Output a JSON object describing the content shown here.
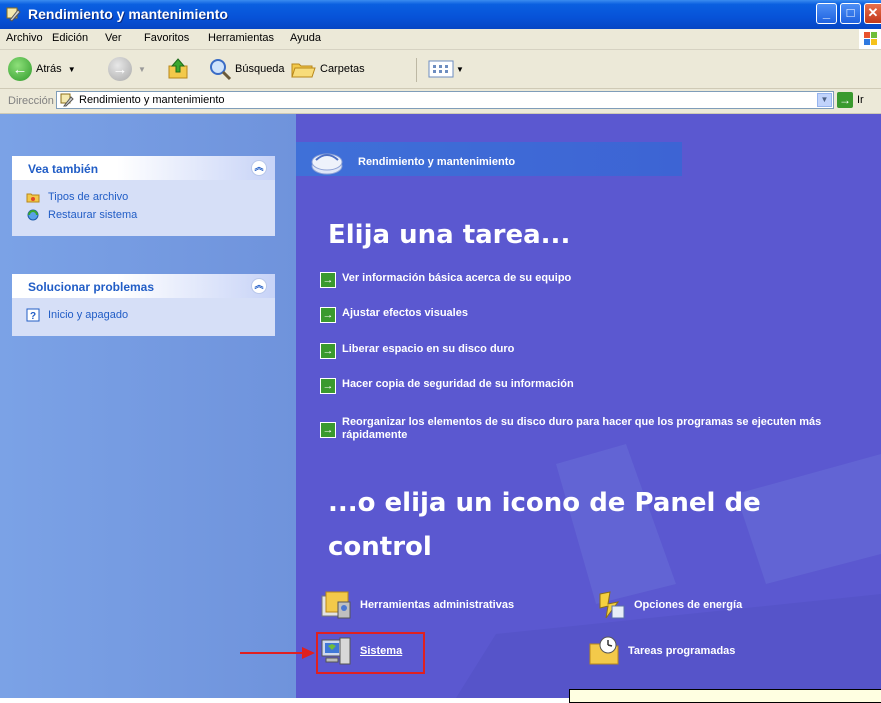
{
  "window": {
    "title": "Rendimiento y mantenimiento"
  },
  "menu": [
    "Archivo",
    "Edición",
    "Ver",
    "Favoritos",
    "Herramientas",
    "Ayuda"
  ],
  "toolbar": {
    "back_label": "Atrás",
    "search_label": "Búsqueda",
    "folders_label": "Carpetas"
  },
  "address": {
    "label": "Dirección",
    "value": "Rendimiento y mantenimiento",
    "go_label": "Ir"
  },
  "sidebar": {
    "see_also": {
      "title": "Vea también",
      "links": [
        "Tipos de archivo",
        "Restaurar sistema"
      ]
    },
    "troubleshoot": {
      "title": "Solucionar problemas",
      "links": [
        "Inicio y apagado"
      ]
    }
  },
  "main": {
    "header_title": "Rendimiento y mantenimiento",
    "task_heading": "Elija una tarea...",
    "tasks": [
      "Ver información básica acerca de su equipo",
      "Ajustar efectos visuales",
      "Liberar espacio en su disco duro",
      "Hacer copia de seguridad de su información",
      "Reorganizar los elementos de su disco duro para hacer que los programas se ejecuten más rápidamente"
    ],
    "icon_heading_line1": "...o elija un icono de Panel de",
    "icon_heading_line2": "control",
    "icons": [
      {
        "label": "Herramientas administrativas",
        "icon": "admin-tools-icon"
      },
      {
        "label": "Opciones de energía",
        "icon": "power-options-icon"
      },
      {
        "label": "Sistema",
        "icon": "system-icon"
      },
      {
        "label": "Tareas programadas",
        "icon": "scheduled-tasks-icon"
      }
    ]
  },
  "colors": {
    "title_bar": "#0752d8",
    "sidebar_bg": "#7ba2e6",
    "main_bg": "#5b58d0",
    "link_blue": "#215dc6",
    "highlight_red": "#e02020"
  }
}
